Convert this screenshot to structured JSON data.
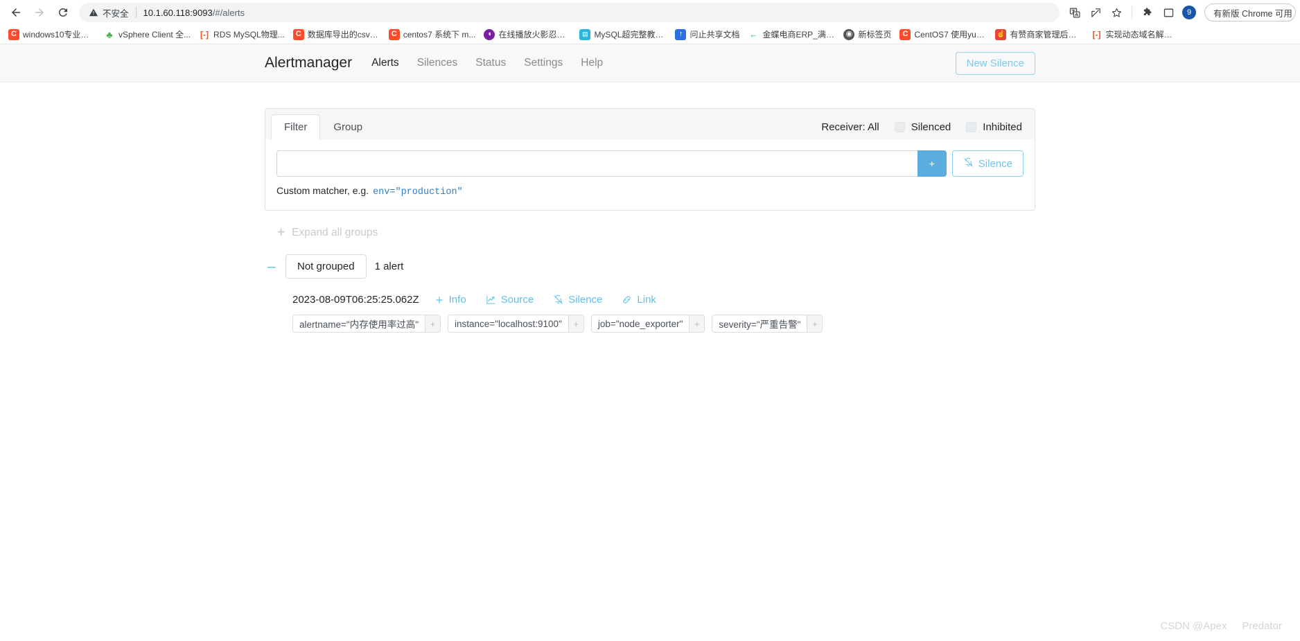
{
  "browser": {
    "back_icon": "back-arrow-icon",
    "forward_icon": "forward-arrow-icon",
    "reload_icon": "reload-icon",
    "security_warning": "不安全",
    "url_host": "10.1.60.118:9093",
    "url_path": "/#/alerts",
    "profile_initial": "9",
    "update_pill_label": "有新版 Chrome 可用",
    "right_icons": [
      "translate-icon",
      "share-icon",
      "bookmark-star-icon",
      "extensions-puzzle-icon",
      "sidepanel-icon"
    ]
  },
  "bookmarks": [
    {
      "label": "windows10专业版...",
      "icon": "C",
      "style": "fav-c"
    },
    {
      "label": "vSphere Client 全...",
      "icon": "♣",
      "style": "fav-tree"
    },
    {
      "label": "RDS MySQL物理...",
      "icon": "[-]",
      "style": "fav-bracket"
    },
    {
      "label": "数据库导出的csv文...",
      "icon": "C",
      "style": "fav-c"
    },
    {
      "label": "centos7 系统下 m...",
      "icon": "C",
      "style": "fav-c"
    },
    {
      "label": "在线播放火影忍者-...",
      "icon": "◖",
      "style": "fav-purple"
    },
    {
      "label": "MySQL超完整教程...",
      "icon": "▤",
      "style": "fav-cal"
    },
    {
      "label": "问止共享文档",
      "icon": "↑",
      "style": "fav-blue"
    },
    {
      "label": "金蝶电商ERP_满足...",
      "icon": "←",
      "style": "fav-dash"
    },
    {
      "label": "新标签页",
      "icon": "◉",
      "style": "fav-globe"
    },
    {
      "label": "CentOS7 使用yum...",
      "icon": "C",
      "style": "fav-c"
    },
    {
      "label": "有赞商家管理后台...",
      "icon": "☝",
      "style": "fav-thumb"
    },
    {
      "label": "实现动态域名解析...",
      "icon": "[-]",
      "style": "fav-bracket"
    }
  ],
  "navbar": {
    "brand": "Alertmanager",
    "links": [
      {
        "label": "Alerts",
        "active": true
      },
      {
        "label": "Silences",
        "active": false
      },
      {
        "label": "Status",
        "active": false
      },
      {
        "label": "Settings",
        "active": false
      },
      {
        "label": "Help",
        "active": false
      }
    ],
    "new_silence_label": "New Silence"
  },
  "filter_card": {
    "tabs": [
      {
        "label": "Filter",
        "active": true
      },
      {
        "label": "Group",
        "active": false
      }
    ],
    "receiver_label": "Receiver: All",
    "checkboxes": [
      {
        "label": "Silenced",
        "checked": false
      },
      {
        "label": "Inhibited",
        "checked": false
      }
    ],
    "filter_input_value": "",
    "filter_input_placeholder": "",
    "add_button_label": "+",
    "silence_button_label": "Silence",
    "matcher_hint_text": "Custom matcher, e.g.",
    "matcher_hint_code": "env=\"production\""
  },
  "alerts_list": {
    "expand_all_label": "Expand all groups",
    "expand_all_icon": "plus-icon",
    "group": {
      "collapse_icon": "minus-icon",
      "pill_label": "Not grouped",
      "count_label": "1 alert"
    },
    "alerts": [
      {
        "timestamp": "2023-08-09T06:25:25.062Z",
        "actions": [
          {
            "label": "Info",
            "icon": "plus-icon"
          },
          {
            "label": "Source",
            "icon": "chart-line-icon"
          },
          {
            "label": "Silence",
            "icon": "bell-slash-icon"
          },
          {
            "label": "Link",
            "icon": "link-icon"
          }
        ],
        "labels": [
          {
            "text": "alertname=\"内存使用率过高\"",
            "add": "+"
          },
          {
            "text": "instance=\"localhost:9100\"",
            "add": "+"
          },
          {
            "text": "job=\"node_exporter\"",
            "add": "+"
          },
          {
            "text": "severity=\"严重告警\"",
            "add": "+"
          }
        ]
      }
    ]
  },
  "watermark": {
    "left": "CSDN @Apex",
    "right": "Predator"
  },
  "colors": {
    "accent_blue": "#62c0e8",
    "add_button_bg": "#5bacdf",
    "navbar_bg": "#f8f8f8",
    "link_blue": "#2f7fc4"
  }
}
